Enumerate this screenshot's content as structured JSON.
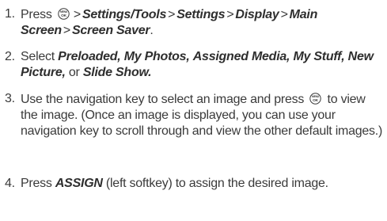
{
  "steps": [
    {
      "number": "1.",
      "prefix": "Press",
      "icon": "menu-ok-key-icon",
      "icon_top": "MENU",
      "icon_bottom": "OK",
      "path": [
        "Settings/Tools",
        "Settings",
        "Display",
        "Main Screen",
        "Screen Saver"
      ],
      "separator": ">",
      "end": "."
    },
    {
      "number": "2.",
      "prefix": "Select",
      "options": [
        "Preloaded,",
        "My Photos,",
        "Assigned Media,",
        "My Stuff,",
        "New Picture,"
      ],
      "conjunction": "or",
      "last_option": "Slide Show.",
      "end": ""
    },
    {
      "number": "3.",
      "line_a": "Use the navigation key to select an image and press",
      "icon": "menu-ok-key-icon",
      "line_b": "to view the image. (Once an image is displayed, you can use your navigation key to scroll through and view the other default images.)"
    },
    {
      "number": "4.",
      "prefix": "Press",
      "softkey": "ASSIGN",
      "suffix": "(left softkey) to assign the desired image."
    }
  ]
}
